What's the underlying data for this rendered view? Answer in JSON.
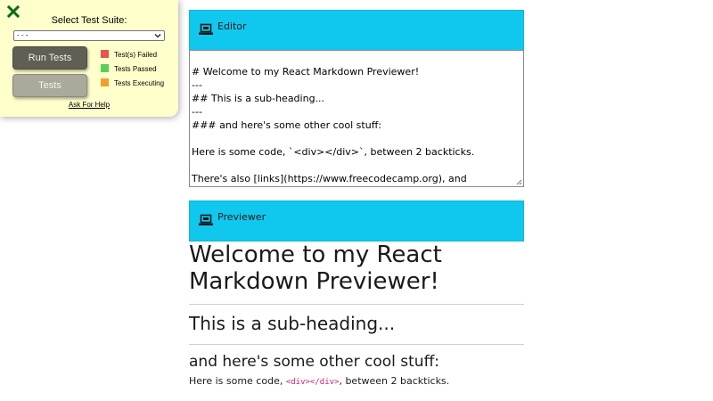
{
  "test_panel": {
    "title": "Select Test Suite:",
    "select_value": "- - -",
    "run_button": "Run Tests",
    "tests_button": "Tests",
    "legend": [
      {
        "label": "Test(s) Failed",
        "color": "#e8554e"
      },
      {
        "label": "Tests Passed",
        "color": "#57d057"
      },
      {
        "label": "Tests Executing",
        "color": "#f2a02a"
      }
    ],
    "help_link": "Ask For Help",
    "close_color": "#0b6b1b"
  },
  "editor": {
    "title": "Editor",
    "icon": "laptop-icon",
    "lines": [
      "# Welcome to my React Markdown Previewer!",
      "---",
      "## This is a sub-heading...",
      "---",
      "### and here's some other cool stuff:",
      "",
      "Here is some code, `<div></div>`, between 2 backticks.",
      "",
      "There's also [links](https://www.freecodecamp.org), and"
    ]
  },
  "previewer": {
    "title": "Previewer",
    "icon": "laptop-icon",
    "h1": "Welcome to my React Markdown Previewer!",
    "h2": "This is a sub-heading...",
    "h3": "and here's some other cool stuff:",
    "p_before": "Here is some code, ",
    "code": "<div></div>",
    "p_after": ", between 2 backticks."
  },
  "colors": {
    "bar": "#10c8ee",
    "panel": "#ffffcc"
  }
}
